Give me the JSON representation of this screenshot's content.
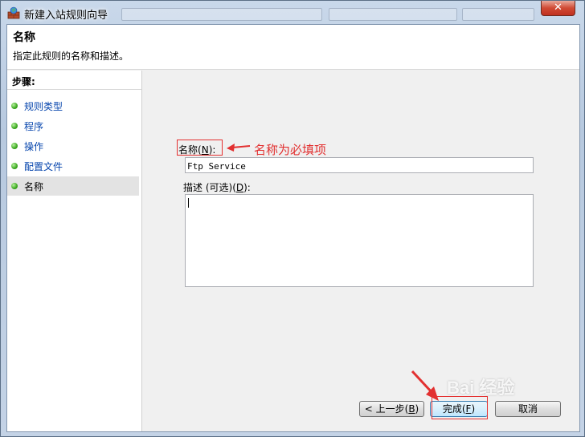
{
  "window": {
    "title": "新建入站规则向导",
    "close_label": "✕"
  },
  "header": {
    "title": "名称",
    "description": "指定此规则的名称和描述。"
  },
  "steps": {
    "title": "步骤:",
    "items": [
      {
        "label": "规则类型"
      },
      {
        "label": "程序"
      },
      {
        "label": "操作"
      },
      {
        "label": "配置文件"
      },
      {
        "label": "名称"
      }
    ]
  },
  "form": {
    "name_label": "名称",
    "name_hotkey": "N",
    "name_value": "Ftp Service",
    "description_label": "描述 (可选)",
    "description_hotkey": "D",
    "description_value": ""
  },
  "annotation": {
    "text": "名称为必填项",
    "color": "#e23030"
  },
  "buttons": {
    "back_label": "< 上一步",
    "back_hotkey": "B",
    "finish_label": "完成",
    "finish_hotkey": "F",
    "cancel_label": "取消"
  },
  "watermark": {
    "text": "Bai 经验"
  }
}
